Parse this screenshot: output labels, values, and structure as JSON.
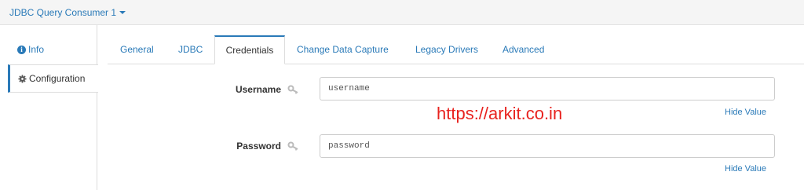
{
  "header": {
    "stage_title": "JDBC Query Consumer 1"
  },
  "sidebar": {
    "items": [
      {
        "label": "Info",
        "icon": "info-icon"
      },
      {
        "label": "Configuration",
        "icon": "gear-icon"
      }
    ],
    "selected": "Configuration"
  },
  "tabs": {
    "items": [
      {
        "label": "General"
      },
      {
        "label": "JDBC"
      },
      {
        "label": "Credentials"
      },
      {
        "label": "Change Data Capture"
      },
      {
        "label": "Legacy Drivers"
      },
      {
        "label": "Advanced"
      }
    ],
    "selected": "Credentials"
  },
  "form": {
    "username": {
      "label": "Username",
      "value": "username",
      "hide_label": "Hide Value",
      "icon": "key-icon"
    },
    "password": {
      "label": "Password",
      "value": "password",
      "hide_label": "Hide Value",
      "icon": "key-icon"
    }
  },
  "watermark": {
    "text": "https://arkit.co.in"
  },
  "colors": {
    "accent": "#2a7ab8",
    "watermark": "#e8231f",
    "topbar_bg": "#f5f5f5"
  }
}
